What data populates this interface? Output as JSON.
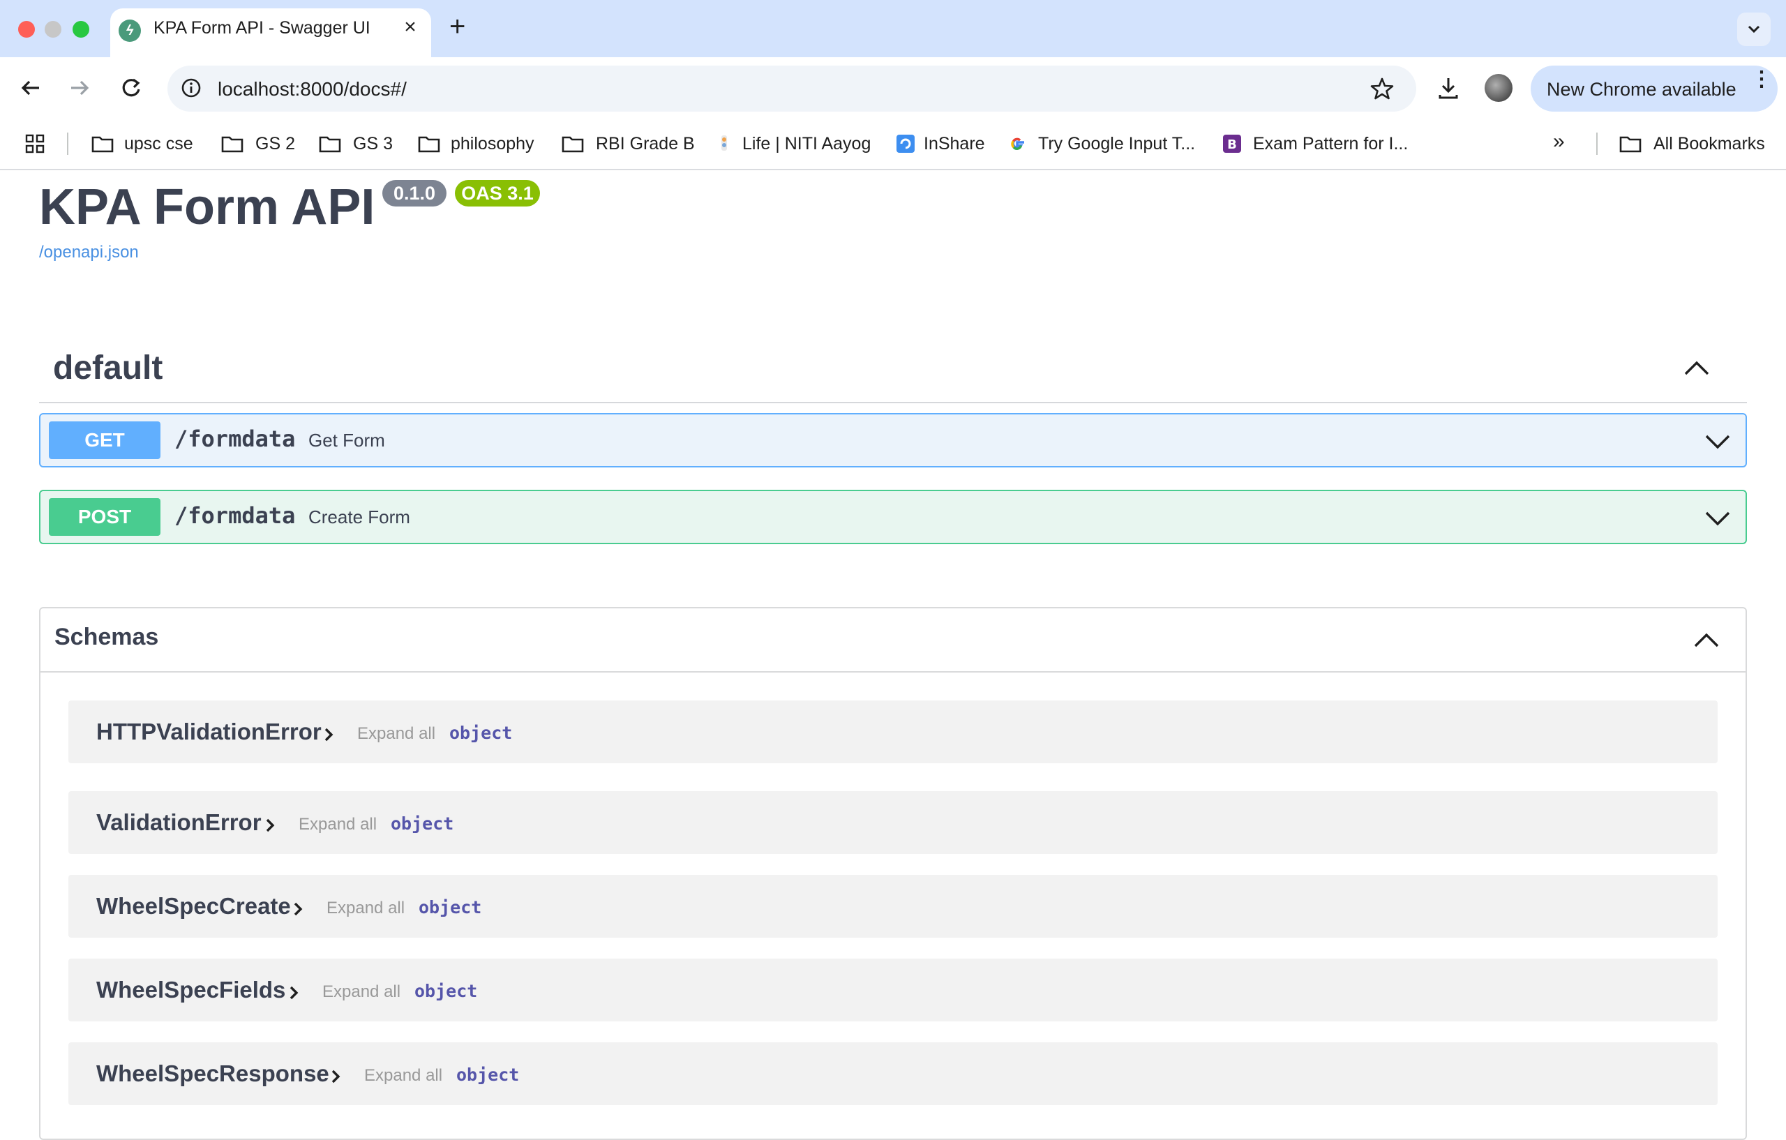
{
  "browser": {
    "tab_title": "KPA Form API - Swagger UI",
    "tab_close": "×",
    "new_tab": "+",
    "url": "localhost:8000/docs#/",
    "update_label": "New Chrome available",
    "update_menu": "⋮",
    "bookmarks": [
      {
        "label": "upsc cse",
        "icon": "folder-icon"
      },
      {
        "label": "GS 2",
        "icon": "folder-icon"
      },
      {
        "label": "GS 3",
        "icon": "folder-icon"
      },
      {
        "label": "philosophy",
        "icon": "folder-icon"
      },
      {
        "label": "RBI Grade B",
        "icon": "folder-icon"
      },
      {
        "label": "Life | NITI Aayog",
        "icon": "niti-favicon"
      },
      {
        "label": "InShare",
        "icon": "inshare-favicon"
      },
      {
        "label": "Try Google Input T...",
        "icon": "google-favicon"
      },
      {
        "label": "Exam Pattern for I...",
        "icon": "site-favicon"
      }
    ],
    "overflow": "»",
    "all_bookmarks": "All Bookmarks"
  },
  "api": {
    "title": "KPA Form API",
    "version_badge": "0.1.0",
    "oas_badge": "OAS 3.1",
    "openapi_link": "/openapi.json",
    "section": "default",
    "operations": [
      {
        "method": "GET",
        "path": "/formdata",
        "summary": "Get Form"
      },
      {
        "method": "POST",
        "path": "/formdata",
        "summary": "Create Form"
      }
    ],
    "schemas_title": "Schemas",
    "schemas": [
      {
        "name": "HTTPValidationError",
        "expand": "Expand all",
        "type": "object"
      },
      {
        "name": "ValidationError",
        "expand": "Expand all",
        "type": "object"
      },
      {
        "name": "WheelSpecCreate",
        "expand": "Expand all",
        "type": "object"
      },
      {
        "name": "WheelSpecFields",
        "expand": "Expand all",
        "type": "object"
      },
      {
        "name": "WheelSpecResponse",
        "expand": "Expand all",
        "type": "object"
      }
    ]
  },
  "colors": {
    "get": "#61affe",
    "post": "#49cc90",
    "version_badge": "#7d8492",
    "oas_badge": "#89bf04",
    "text": "#3b4151"
  }
}
